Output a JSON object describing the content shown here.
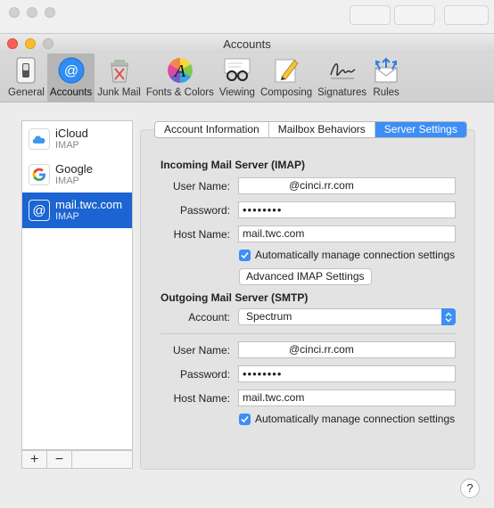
{
  "window": {
    "title": "Accounts"
  },
  "toolbar": {
    "items": [
      {
        "label": "General",
        "icon": "general-switch-icon"
      },
      {
        "label": "Accounts",
        "icon": "at-sign-icon",
        "selected": true
      },
      {
        "label": "Junk Mail",
        "icon": "trash-bin-icon"
      },
      {
        "label": "Fonts & Colors",
        "icon": "color-wheel-font-icon"
      },
      {
        "label": "Viewing",
        "icon": "glasses-icon"
      },
      {
        "label": "Composing",
        "icon": "pencil-paper-icon"
      },
      {
        "label": "Signatures",
        "icon": "signature-icon"
      },
      {
        "label": "Rules",
        "icon": "envelope-arrows-icon"
      }
    ]
  },
  "accounts": [
    {
      "name": "iCloud",
      "type": "IMAP",
      "icon": "icloud-icon"
    },
    {
      "name": "Google",
      "type": "IMAP",
      "icon": "google-icon"
    },
    {
      "name": "mail.twc.com",
      "type": "IMAP",
      "icon": "at-sign-icon",
      "selected": true
    }
  ],
  "list_footer": {
    "add": "+",
    "remove": "−"
  },
  "tabs": [
    {
      "label": "Account Information"
    },
    {
      "label": "Mailbox Behaviors"
    },
    {
      "label": "Server Settings",
      "active": true
    }
  ],
  "incoming": {
    "title": "Incoming Mail Server (IMAP)",
    "user_label": "User Name:",
    "user_value": "@cinci.rr.com",
    "password_label": "Password:",
    "password_value": "••••••••",
    "host_label": "Host Name:",
    "host_value": "mail.twc.com",
    "auto_manage": "Automatically manage connection settings",
    "advanced_button": "Advanced IMAP Settings"
  },
  "outgoing": {
    "title": "Outgoing Mail Server (SMTP)",
    "account_label": "Account:",
    "account_value": "Spectrum",
    "user_label": "User Name:",
    "user_value": "@cinci.rr.com",
    "password_label": "Password:",
    "password_value": "••••••••",
    "host_label": "Host Name:",
    "host_value": "mail.twc.com",
    "auto_manage": "Automatically manage connection settings"
  },
  "help": "?",
  "colors": {
    "accent": "#3d8ef5",
    "selection": "#1b64d1",
    "close": "#fc5f57",
    "minimize": "#fdbc2e"
  }
}
